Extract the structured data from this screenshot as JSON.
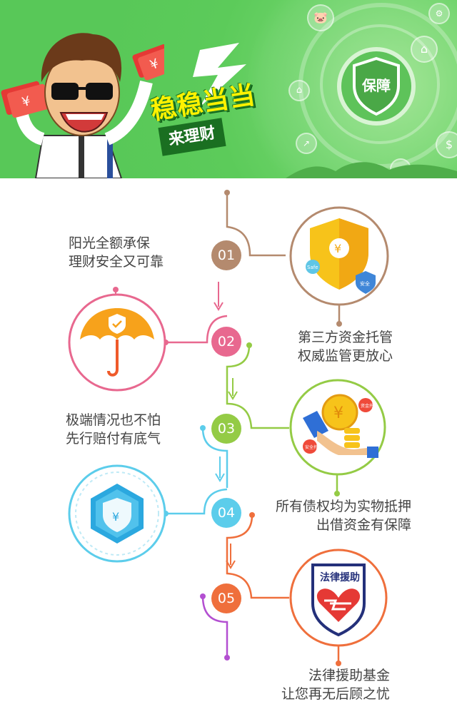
{
  "banner": {
    "title": "稳稳当当",
    "subtitle": "来理财",
    "badge_text": "保障"
  },
  "steps": [
    {
      "number": "01",
      "color": "#b48a6e",
      "caption_lines": [
        "阳光全额承保",
        "理财安全又可靠"
      ],
      "icon": "shield-yen-icon",
      "icon_caption_lines": [
        "第三方资金托管",
        "权威监管更放心"
      ]
    },
    {
      "number": "02",
      "color": "#e8688f",
      "icon": "umbrella-shield-icon"
    },
    {
      "number": "03",
      "color": "#94cb45",
      "caption_lines": [
        "极端情况也不怕",
        "先行赔付有底气"
      ],
      "icon": "coins-hands-icon"
    },
    {
      "number": "04",
      "color": "#5ccdeb",
      "icon": "hexagon-shield-icon",
      "icon_caption_lines": [
        "所有债权均为实物抵押",
        "出借资金有保障"
      ]
    },
    {
      "number": "05",
      "color": "#ef6f3c",
      "icon": "legal-aid-heart-icon",
      "badge_label": "法律援助",
      "icon_caption_lines": [
        "法律援助基金",
        "让您再无后顾之忧"
      ]
    }
  ],
  "icon_labels": {
    "safe": "Safe",
    "protect": "安全",
    "coin_tag1": "资金托管",
    "coin_tag2": "安全托管"
  },
  "colors": {
    "brown": "#b48a6e",
    "pink": "#e8688f",
    "green": "#94cb45",
    "cyan": "#5ccdeb",
    "orange": "#ef6f3c",
    "purple": "#b34fd1"
  }
}
